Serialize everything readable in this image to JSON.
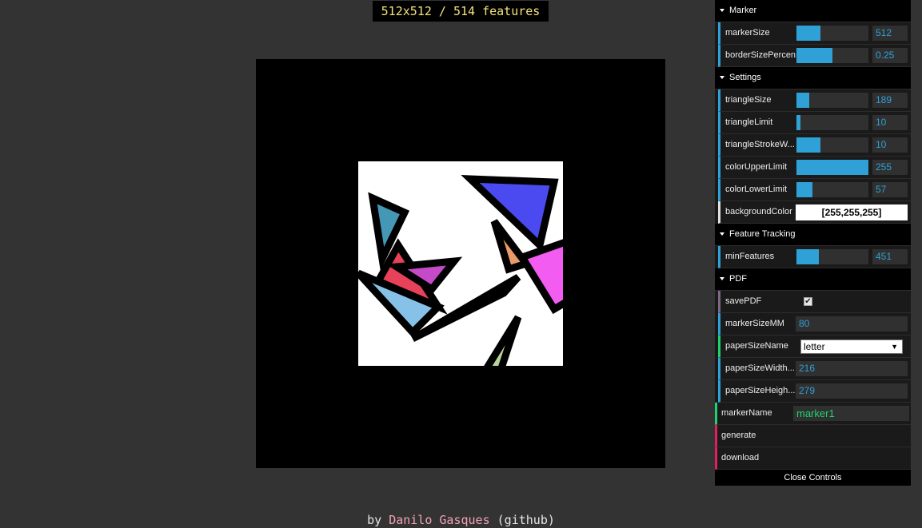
{
  "status": "512x512 / 514 features",
  "footer": {
    "prefix": "by ",
    "author": "Danilo Gasques",
    "link": "(github)"
  },
  "gui": {
    "folders": {
      "marker": "Marker",
      "settings": "Settings",
      "tracking": "Feature Tracking",
      "pdf": "PDF"
    },
    "markerSize": {
      "label": "markerSize",
      "value": "512",
      "fill": 0.33
    },
    "borderSizePercent": {
      "label": "borderSizePercen",
      "value": "0.25",
      "fill": 0.5
    },
    "triangleSize": {
      "label": "triangleSize",
      "value": "189",
      "fill": 0.18
    },
    "triangleLimit": {
      "label": "triangleLimit",
      "value": "10",
      "fill": 0.05
    },
    "triangleStrokeWidth": {
      "label": "triangleStrokeW...",
      "value": "10",
      "fill": 0.33
    },
    "colorUpperLimit": {
      "label": "colorUpperLimit",
      "value": "255",
      "fill": 1.0
    },
    "colorLowerLimit": {
      "label": "colorLowerLimit",
      "value": "57",
      "fill": 0.22
    },
    "backgroundColor": {
      "label": "backgroundColor",
      "value": "[255,255,255]"
    },
    "minFeatures": {
      "label": "minFeatures",
      "value": "451",
      "fill": 0.31
    },
    "savePDF": {
      "label": "savePDF",
      "checked": true
    },
    "markerSizeMM": {
      "label": "markerSizeMM",
      "value": "80"
    },
    "paperSizeName": {
      "label": "paperSizeName",
      "value": "letter"
    },
    "paperSizeWidth": {
      "label": "paperSizeWidth...",
      "value": "216"
    },
    "paperSizeHeight": {
      "label": "paperSizeHeigh...",
      "value": "279"
    },
    "markerName": {
      "label": "markerName",
      "value": "marker1"
    },
    "generate": "generate",
    "download": "download",
    "close": "Close Controls"
  },
  "colors": {
    "accent": "#2fa1d6",
    "string": "#1ed36f",
    "function": "#e61d5f",
    "boolean": "#806787",
    "option": "#1ed36f",
    "statusText": "#f6e37a"
  }
}
